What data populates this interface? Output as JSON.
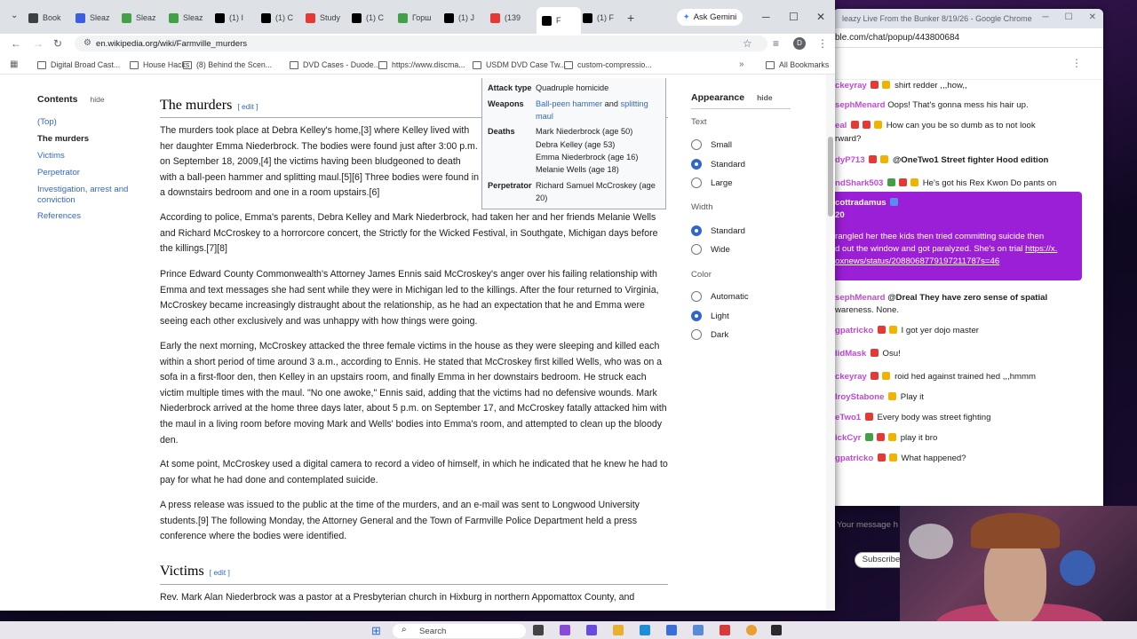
{
  "browser": {
    "tabs": [
      {
        "label": "Book",
        "color": "#3c4043"
      },
      {
        "label": "Sleaz",
        "color": "#3b5fe0"
      },
      {
        "label": "Sleaz",
        "color": "#43a047"
      },
      {
        "label": "Sleaz",
        "color": "#43a047"
      },
      {
        "label": "(1) I",
        "color": "#000000"
      },
      {
        "label": "(1) C",
        "color": "#000000"
      },
      {
        "label": "Study",
        "color": "#e53935"
      },
      {
        "label": "(1) C",
        "color": "#000000"
      },
      {
        "label": "Горш",
        "color": "#43a047"
      },
      {
        "label": "(1) J",
        "color": "#000000"
      },
      {
        "label": "(139",
        "color": "#e53935"
      },
      {
        "label": "F",
        "color": "#000000"
      },
      {
        "label": "(1) F",
        "color": "#000000"
      }
    ],
    "new_tab": "+",
    "gemini_label": "Ask Gemini",
    "url": "en.wikipedia.org/wiki/Farmville_murders",
    "bookmarks": [
      "Digital Broad Cast...",
      "House Hacks",
      "(8) Behind the Scen...",
      "DVD Cases - Duode...",
      "https://www.discma...",
      "USDM DVD Case Tw...",
      "custom-compressio..."
    ],
    "more_bookmarks": "»",
    "all_bookmarks": "All Bookmarks"
  },
  "toc": {
    "title": "Contents",
    "hide": "hide",
    "items": [
      "(Top)",
      "The murders",
      "Victims",
      "Perpetrator",
      "Investigation, arrest and conviction",
      "References"
    ]
  },
  "infobox": {
    "attack_type_label": "Attack type",
    "attack_type": "Quadruple homicide",
    "weapons_label": "Weapons",
    "weapon1": "Ball-peen hammer",
    "weapons_and": "and",
    "weapon2": "splitting maul",
    "deaths_label": "Deaths",
    "deaths": [
      "Mark Niederbrock (age 50)",
      "Debra Kelley (age 53)",
      "Emma Niederbrock (age 16)",
      "Melanie Wells (age 18)"
    ],
    "perpetrator_label": "Perpetrator",
    "perpetrator": "Richard Samuel McCroskey (age 20)"
  },
  "article": {
    "h_murders": "The murders",
    "h_victims": "Victims",
    "edit": "edit",
    "p1": "The murders took place at Debra Kelley's home,[3] where Kelley lived with her daughter Emma Niederbrock. The bodies were found just after 3:00 p.m. on September 18, 2009,[4] the victims having been bludgeoned to death with a ball-peen hammer and splitting maul.[5][6] Three bodies were found in a downstairs bedroom and one in a room upstairs.[6]",
    "p2": "According to police, Emma's parents, Debra Kelley and Mark Niederbrock, had taken her and her friends Melanie Wells and Richard McCroskey to a horrorcore concert, the Strictly for the Wicked Festival, in Southgate, Michigan days before the killings.[7][8]",
    "p3": "Prince Edward County Commonwealth's Attorney James Ennis said McCroskey's anger over his failing relationship with Emma and text messages she had sent while they were in Michigan led to the killings. After the four returned to Virginia, McCroskey became increasingly distraught about the relationship, as he had an expectation that he and Emma were seeing each other exclusively and was unhappy with how things were going.",
    "p4": "Early the next morning, McCroskey attacked the three female victims in the house as they were sleeping and killed each within a short period of time around 3 a.m., according to Ennis. He stated that McCroskey first killed Wells, who was on a sofa in a first-floor den, then Kelley in an upstairs room, and finally Emma in her downstairs bedroom. He struck each victim multiple times with the maul. \"No one awoke,\" Ennis said, adding that the victims had no defensive wounds. Mark Niederbrock arrived at the home three days later, about 5 p.m. on September 17, and McCroskey fatally attacked him with the maul in a living room before moving Mark and Wells' bodies into Emma's room, and attempted to clean up the bloody den.",
    "p5": "At some point, McCroskey used a digital camera to record a video of himself, in which he indicated that he knew he had to pay for what he had done and contemplated suicide.",
    "p6": "A press release was issued to the public at the time of the murders, and an e-mail was sent to Longwood University students.[9] The following Monday, the Attorney General and the Town of Farmville Police Department held a press conference where the bodies were identified.",
    "p7": "Rev. Mark Alan Niederbrock was a pastor at a Presbyterian church in Hixburg in northern Appomattox County, and"
  },
  "appearance": {
    "title": "Appearance",
    "hide": "hide",
    "text_label": "Text",
    "text_options": [
      "Small",
      "Standard",
      "Large"
    ],
    "text_selected": "Standard",
    "width_label": "Width",
    "width_options": [
      "Standard",
      "Wide"
    ],
    "width_selected": "Standard",
    "color_label": "Color",
    "color_options": [
      "Automatic",
      "Light",
      "Dark"
    ],
    "color_selected": "Light"
  },
  "chat_window": {
    "title": "leazy Live From the Bunker 8/19/26 - Google Chrome",
    "url": "ble.com/chat/popup/443800684",
    "messages": [
      {
        "user": "ckeyray",
        "text": "shirt redder ,,,how,,"
      },
      {
        "user": "sephMenard",
        "text": "Oops! That's gonna mess his hair up."
      },
      {
        "user": "eal",
        "text": "How can you be so dumb as to not look"
      },
      {
        "user": "",
        "text": "rward?"
      },
      {
        "user": "dyP713",
        "text": "@OneTwo1 Street fighter Hood edition"
      },
      {
        "user": "ndShark503",
        "text": "He's got his Rex Kwon Do pants on"
      },
      {
        "user": "sephMenard",
        "text": "@Dreal They have zero sense of spatial"
      },
      {
        "user": "",
        "text": "wareness. None."
      },
      {
        "user": "gpatricko",
        "text": "I got yer dojo master"
      },
      {
        "user": "lidMask",
        "text": "Osu!"
      },
      {
        "user": "ckeyray",
        "text": "roid hed against trained hed ,,,hmmm"
      },
      {
        "user": "lroyStabone",
        "text": "Play it"
      },
      {
        "user": "eTwo1",
        "text": "Every body was street fighting"
      },
      {
        "user": "ickCyr",
        "text": "play it bro"
      },
      {
        "user": "gpatricko",
        "text": "What happened?"
      }
    ],
    "highlight_user": "cottradamus",
    "highlight_amount": "20",
    "highlight_text1": "rangled her thee kids then tried committing suicide then",
    "highlight_text2": "d out the window and got paralyzed. She's on trial",
    "highlight_link1": "https://x.",
    "highlight_link2": "oxnews/status/2088068779197211787s=46",
    "input_placeholder": "Your message h",
    "subscribe": "Subscribe"
  },
  "taskbar": {
    "search": "Search"
  }
}
